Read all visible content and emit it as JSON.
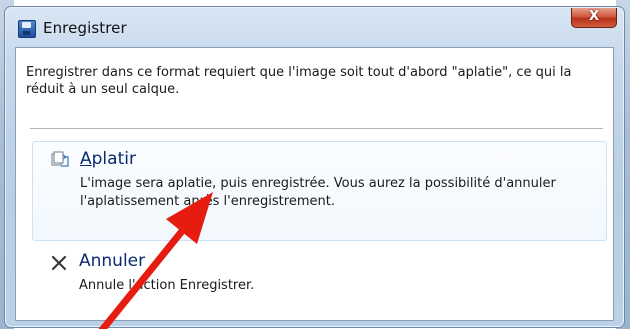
{
  "dialog": {
    "title": "Enregistrer",
    "close_label": "X",
    "message": "Enregistrer dans ce format requiert que l'image soit tout d'abord \"aplatie\", ce qui la réduit à un seul calque.",
    "options": [
      {
        "access_key": "A",
        "title_rest": "platir",
        "description": "L'image sera aplatie, puis enregistrée. Vous aurez la possibilité d'annuler l'aplatissement après l'enregistrement."
      },
      {
        "title": "Annuler",
        "description": "Annule l'action Enregistrer."
      }
    ]
  },
  "annotation": {
    "arrow_color": "#e51c0f"
  },
  "colors": {
    "title_text": "#0a2a6f",
    "close_button": "#c8452a"
  }
}
